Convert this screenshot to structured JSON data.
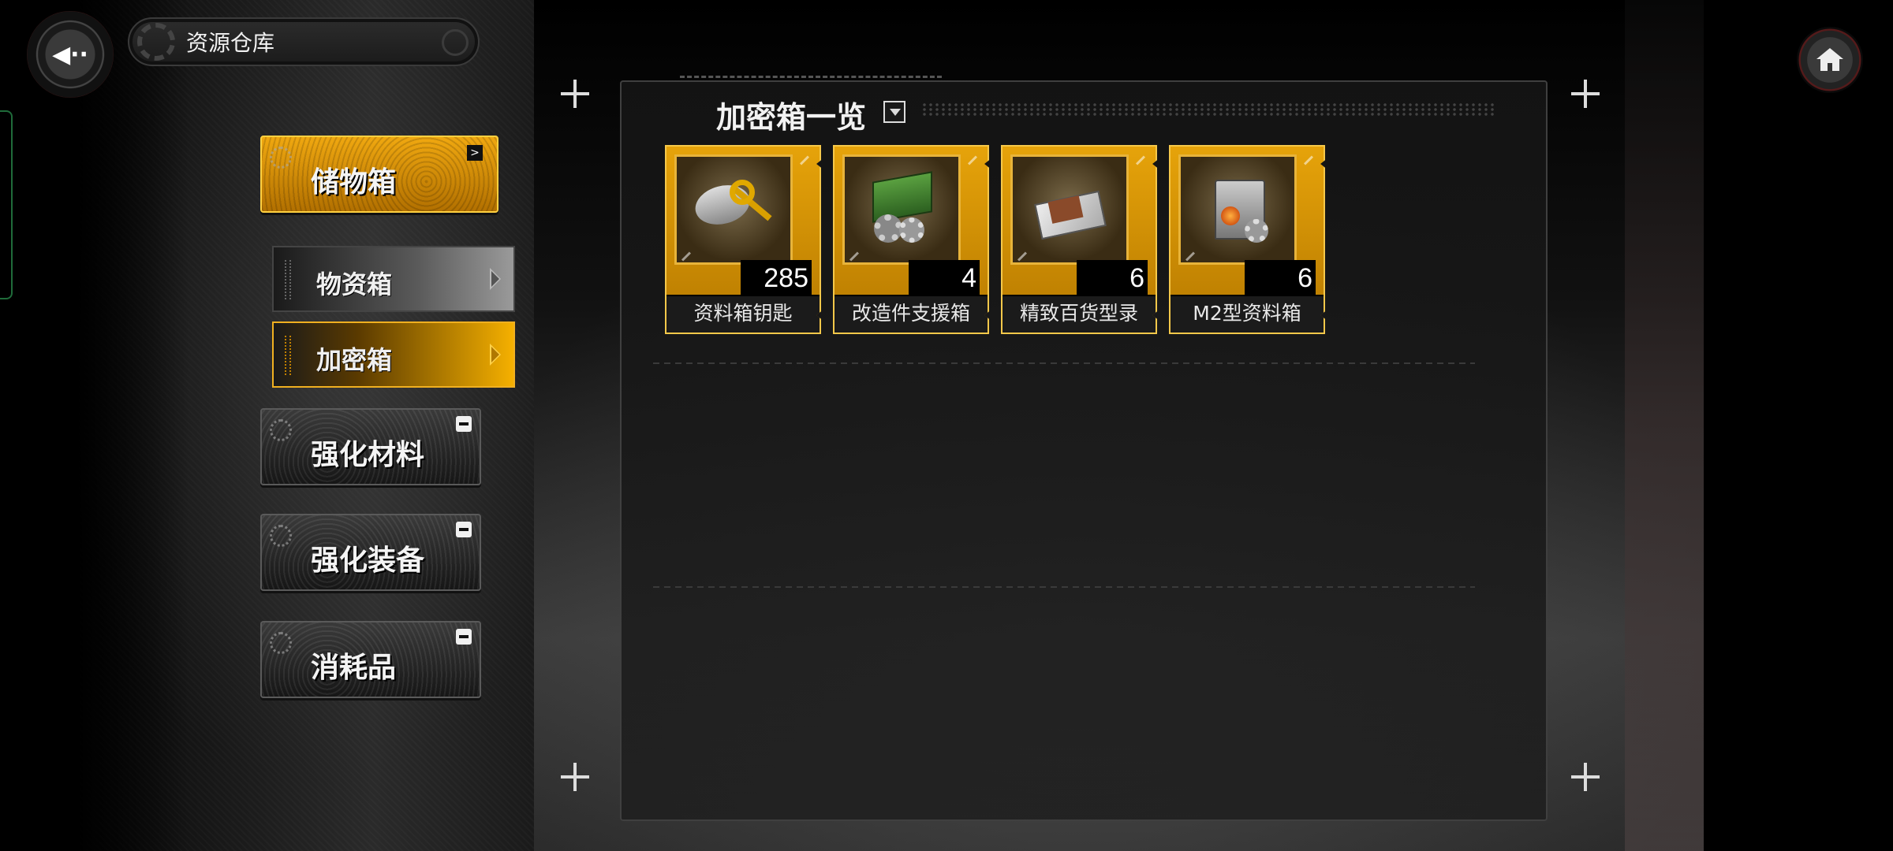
{
  "header": {
    "title": "资源仓库",
    "back_icon": "back-arrow-icon",
    "home_icon": "home-icon"
  },
  "sidebar": {
    "categories": [
      {
        "label": "储物箱",
        "state": "expanded",
        "indicator": "chevron-right-icon"
      },
      {
        "label": "强化材料",
        "state": "collapsed",
        "indicator": "minus-icon"
      },
      {
        "label": "强化装备",
        "state": "collapsed",
        "indicator": "minus-icon"
      },
      {
        "label": "消耗品",
        "state": "collapsed",
        "indicator": "minus-icon"
      }
    ],
    "subitems": [
      {
        "label": "物资箱",
        "selected": false
      },
      {
        "label": "加密箱",
        "selected": true
      }
    ]
  },
  "main": {
    "section_title": "加密箱一览",
    "items": [
      {
        "name": "资料箱钥匙",
        "count": "285",
        "icon": "key-icon"
      },
      {
        "name": "改造件支援箱",
        "count": "4",
        "icon": "crate-icon"
      },
      {
        "name": "精致百货型录",
        "count": "6",
        "icon": "catalog-icon"
      },
      {
        "name": "M2型资料箱",
        "count": "6",
        "icon": "m2-box-icon"
      }
    ]
  },
  "colors": {
    "accent": "#f0a810",
    "accent_border": "#ffd040",
    "panel_bg": "#141414",
    "text": "#f2f2f2"
  }
}
